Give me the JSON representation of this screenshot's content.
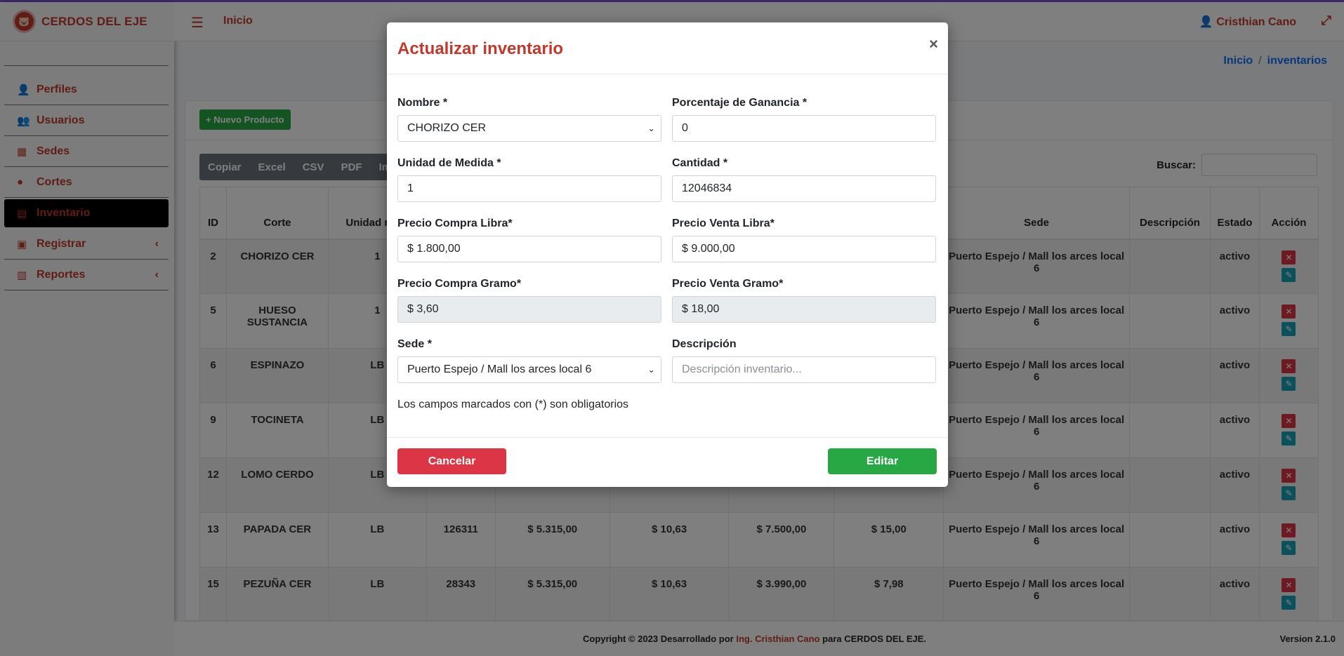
{
  "brand": {
    "name": "CERDOS DEL EJE",
    "logo_icon": "pig-logo"
  },
  "sidebar": {
    "items": [
      {
        "label": "Perfiles",
        "icon": "user-tag-icon"
      },
      {
        "label": "Usuarios",
        "icon": "users-icon"
      },
      {
        "label": "Sedes",
        "icon": "store-icon"
      },
      {
        "label": "Cortes",
        "icon": "piggy-icon"
      },
      {
        "label": "Inventario",
        "icon": "inventory-icon"
      },
      {
        "label": "Registrar",
        "icon": "file-icon"
      },
      {
        "label": "Reportes",
        "icon": "chart-icon"
      }
    ]
  },
  "navbar": {
    "home": "Inicio",
    "user": "Cristhian Cano"
  },
  "breadcrumb": {
    "home": "Inicio",
    "current": "inventarios"
  },
  "toolbar": {
    "new_product": "+ Nuevo Producto",
    "export_buttons": [
      "Copiar",
      "Excel",
      "CSV",
      "PDF",
      "Im"
    ],
    "search_label": "Buscar:"
  },
  "table": {
    "headers": [
      "ID",
      "Corte",
      "Unidad medi",
      "",
      "",
      "",
      "",
      "",
      "Sede",
      "Descripción",
      "Estado",
      "Acción"
    ],
    "rows": [
      {
        "id": "2",
        "corte": "CHORIZO CER",
        "unidad": "1",
        "cantidad": "",
        "pcl": "",
        "pcg": "",
        "pvl": "",
        "pvg": "",
        "sede": "Puerto Espejo / Mall los arces local 6",
        "desc": "",
        "estado": "activo"
      },
      {
        "id": "5",
        "corte": "HUESO SUSTANCIA",
        "unidad": "1",
        "cantidad": "",
        "pcl": "",
        "pcg": "",
        "pvl": "",
        "pvg": "",
        "sede": "Puerto Espejo / Mall los arces local 6",
        "desc": "",
        "estado": "activo"
      },
      {
        "id": "6",
        "corte": "ESPINAZO",
        "unidad": "LB",
        "cantidad": "",
        "pcl": "",
        "pcg": "",
        "pvl": "",
        "pvg": "",
        "sede": "Puerto Espejo / Mall los arces local 6",
        "desc": "",
        "estado": "activo"
      },
      {
        "id": "9",
        "corte": "TOCINETA",
        "unidad": "LB",
        "cantidad": "",
        "pcl": "",
        "pcg": "",
        "pvl": "",
        "pvg": "",
        "sede": "Puerto Espejo / Mall los arces local 6",
        "desc": "",
        "estado": "activo"
      },
      {
        "id": "12",
        "corte": "LOMO CERDO",
        "unidad": "LB",
        "cantidad": "",
        "pcl": "",
        "pcg": "",
        "pvl": "",
        "pvg": "",
        "sede": "Puerto Espejo / Mall los arces local 6",
        "desc": "",
        "estado": "activo"
      },
      {
        "id": "13",
        "corte": "PAPADA CER",
        "unidad": "LB",
        "cantidad": "126311",
        "pcl": "$ 5.315,00",
        "pcg": "$ 10,63",
        "pvl": "$ 7.500,00",
        "pvg": "$ 15,00",
        "sede": "Puerto Espejo / Mall los arces local 6",
        "desc": "",
        "estado": "activo"
      },
      {
        "id": "15",
        "corte": "PEZUÑA CER",
        "unidad": "LB",
        "cantidad": "28343",
        "pcl": "$ 5.315,00",
        "pcg": "$ 10,63",
        "pvl": "$ 3.990,00",
        "pvg": "$ 7,98",
        "sede": "Puerto Espejo / Mall los arces local 6",
        "desc": "",
        "estado": "activo"
      }
    ]
  },
  "footer": {
    "copy_prefix": "Copyright © 2023 Desarrollado por",
    "copy_link": "Ing. Cristhian Cano",
    "copy_suffix": "para CERDOS DEL EJE.",
    "version": "Version 2.1.0"
  },
  "modal": {
    "title": "Actualizar inventario",
    "close": "×",
    "fields": {
      "nombre": {
        "label": "Nombre *",
        "value": "CHORIZO CER"
      },
      "ganancia": {
        "label": "Porcentaje de Ganancia *",
        "value": "0"
      },
      "unidad": {
        "label": "Unidad de Medida *",
        "value": "1"
      },
      "cantidad": {
        "label": "Cantidad *",
        "value": "12046834"
      },
      "pcl": {
        "label": "Precio Compra Libra*",
        "value": "$ 1.800,00"
      },
      "pvl": {
        "label": "Precio Venta Libra*",
        "value": "$ 9.000,00"
      },
      "pcg": {
        "label": "Precio Compra Gramo*",
        "value": "$ 3,60"
      },
      "pvg": {
        "label": "Precio Venta Gramo*",
        "value": "$ 18,00"
      },
      "sede": {
        "label": "Sede *",
        "value": "Puerto Espejo / Mall los arces local 6"
      },
      "descripcion": {
        "label": "Descripción",
        "placeholder": "Descripción inventario..."
      }
    },
    "note": "Los campos marcados con (*) son obligatorios",
    "cancel": "Cancelar",
    "submit": "Editar"
  },
  "colors": {
    "brand": "#c0392b",
    "success": "#28a745",
    "danger": "#dc3545",
    "info": "#17a2b8"
  }
}
